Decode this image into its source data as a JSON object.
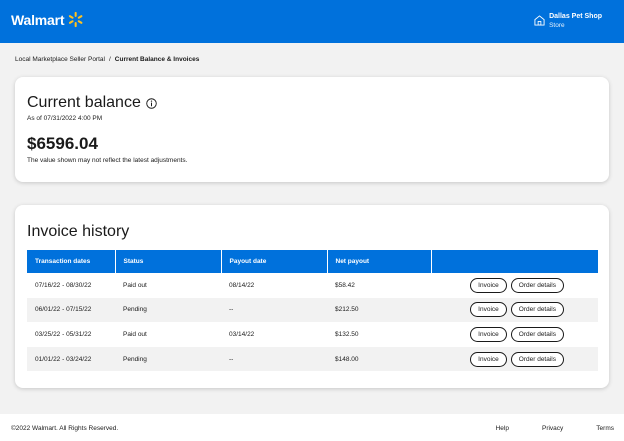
{
  "header": {
    "logo_text": "Walmart",
    "store_name": "Dallas Pet Shop",
    "store_label": "Store"
  },
  "breadcrumb": {
    "parent": "Local Marketplace Seller Portal",
    "separator": "/",
    "current": "Current Balance & Invoices"
  },
  "balance": {
    "title": "Current balance",
    "as_of": "As of 07/31/2022 4:00 PM",
    "amount": "$6596.04",
    "note": "The value shown may not reflect the latest adjustments."
  },
  "invoices": {
    "title": "Invoice history",
    "columns": [
      "Transaction dates",
      "Status",
      "Payout date",
      "Net payout",
      ""
    ],
    "invoice_label": "Invoice",
    "order_details_label": "Order details",
    "rows": [
      {
        "dates": "07/16/22 - 08/30/22",
        "status": "Paid out",
        "payout_date": "08/14/22",
        "net": "$58.42"
      },
      {
        "dates": "06/01/22 - 07/15/22",
        "status": "Pending",
        "payout_date": "--",
        "net": "$212.50"
      },
      {
        "dates": "03/25/22 - 05/31/22",
        "status": "Paid out",
        "payout_date": "03/14/22",
        "net": "$132.50"
      },
      {
        "dates": "01/01/22 - 03/24/22",
        "status": "Pending",
        "payout_date": "--",
        "net": "$148.00"
      }
    ]
  },
  "footer": {
    "copyright": "©2022 Walmart. All Rights Reserved.",
    "links": [
      "Help",
      "Privacy",
      "Terms"
    ]
  },
  "colors": {
    "brand_blue": "#0071dc",
    "spark_yellow": "#ffc220"
  },
  "icons": [
    "spark-icon",
    "store-icon",
    "info-icon"
  ]
}
